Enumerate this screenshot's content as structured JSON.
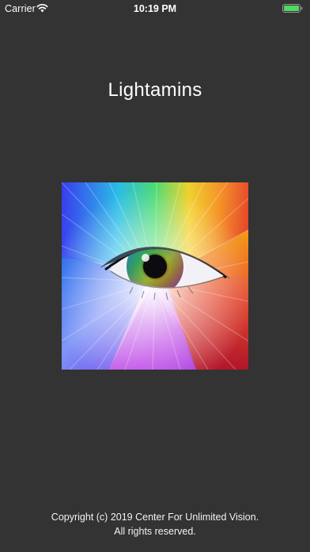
{
  "status_bar": {
    "carrier": "Carrier",
    "time": "10:19 PM",
    "battery_color": "#4cd964",
    "wifi_icon": "wifi-icon",
    "battery_icon": "battery-icon"
  },
  "screen": {
    "title": "Lightamins",
    "image_icon": "rainbow-eye-image",
    "background_color": "#333333"
  },
  "footer": {
    "copyright_line": "Copyright (c) 2019 Center For Unlimited Vision.",
    "rights_line": "All rights reserved."
  }
}
